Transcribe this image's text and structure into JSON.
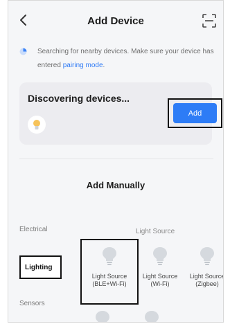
{
  "header": {
    "title": "Add Device",
    "back_icon": "chevron-left-icon",
    "scan_icon": "scan-icon"
  },
  "notice": {
    "text": "Searching for nearby devices. Make sure your device has entered ",
    "link": "pairing mode",
    "suffix": "."
  },
  "discover": {
    "title": "Discovering devices...",
    "add_label": "Add"
  },
  "manual": {
    "title": "Add Manually",
    "categories": {
      "electrical": "Electrical",
      "lighting": "Lighting",
      "sensors": "Sensors"
    },
    "section_label": "Light Source",
    "devices": [
      {
        "line1": "Light Source",
        "line2": "(BLE+Wi-Fi)"
      },
      {
        "line1": "Light Source",
        "line2": "(Wi-Fi)"
      },
      {
        "line1": "Light Source",
        "line2": "(Zigbee)"
      }
    ]
  },
  "colors": {
    "accent": "#2d7cf6",
    "link": "#2f7bf5",
    "background": "#f5f6f8",
    "card": "#ececf0",
    "bulb": "#d5d9de"
  }
}
